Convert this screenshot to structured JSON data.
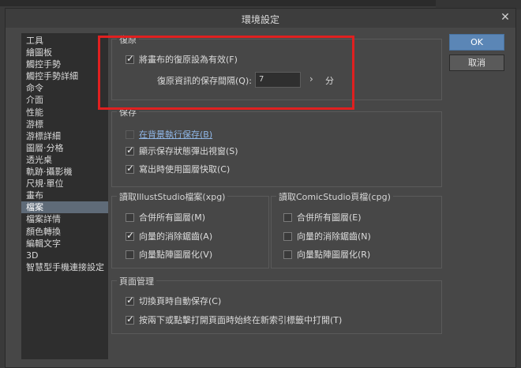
{
  "window": {
    "title": "環境設定",
    "close_icon": "close-icon"
  },
  "sidebar": {
    "items": [
      {
        "label": "工具"
      },
      {
        "label": "繪圖板"
      },
      {
        "label": "觸控手勢"
      },
      {
        "label": "觸控手勢詳細"
      },
      {
        "label": "命令"
      },
      {
        "label": "介面"
      },
      {
        "label": "性能"
      },
      {
        "label": "游標"
      },
      {
        "label": "游標詳細"
      },
      {
        "label": "圖層·分格"
      },
      {
        "label": "透光桌"
      },
      {
        "label": "軌跡·攝影機"
      },
      {
        "label": "尺規·單位"
      },
      {
        "label": "畫布"
      },
      {
        "label": "檔案"
      },
      {
        "label": "檔案詳情"
      },
      {
        "label": "顏色轉換"
      },
      {
        "label": "編輯文字"
      },
      {
        "label": "3D"
      },
      {
        "label": "智慧型手機連接設定"
      }
    ],
    "selected": "檔案"
  },
  "undo_group": {
    "title": "復原",
    "enable_canvas_undo": {
      "label": "將畫布的復原設為有效(F)",
      "checked": true
    },
    "interval_label": "復原資訊的保存間隔(Q):",
    "interval_value": "7",
    "interval_unit": "分"
  },
  "save_group": {
    "title": "保存",
    "bg_save": {
      "label": "在背景執行保存(B)",
      "checked": false
    },
    "show_progress": {
      "label": "顯示保存狀態彈出視窗(S)",
      "checked": true
    },
    "layer_cache": {
      "label": "寫出時使用圖層快取(C)",
      "checked": true
    }
  },
  "illust_group": {
    "title": "讀取IllustStudio檔案(xpg)",
    "merge": {
      "label": "合併所有圖層(M)",
      "checked": false
    },
    "antialias": {
      "label": "向量的消除鋸齒(A)",
      "checked": true
    },
    "rasterize": {
      "label": "向量點陣圖層化(V)",
      "checked": false
    }
  },
  "comic_group": {
    "title": "讀取ComicStudio頁檔(cpg)",
    "merge": {
      "label": "合併所有圖層(E)",
      "checked": false
    },
    "antialias": {
      "label": "向量的消除鋸齒(N)",
      "checked": false
    },
    "rasterize": {
      "label": "向量點陣圖層化(R)",
      "checked": false
    }
  },
  "page_group": {
    "title": "頁面管理",
    "auto_save": {
      "label": "切換頁時自動保存(C)",
      "checked": true
    },
    "new_tab": {
      "label": "按兩下或點擊打開頁面時始終在新索引標籤中打開(T)",
      "checked": true
    }
  },
  "buttons": {
    "ok": "OK",
    "cancel": "取消"
  },
  "colors": {
    "accent": "#5b86b6",
    "highlight": "#e02020",
    "selected_item": "#5f6b78"
  }
}
